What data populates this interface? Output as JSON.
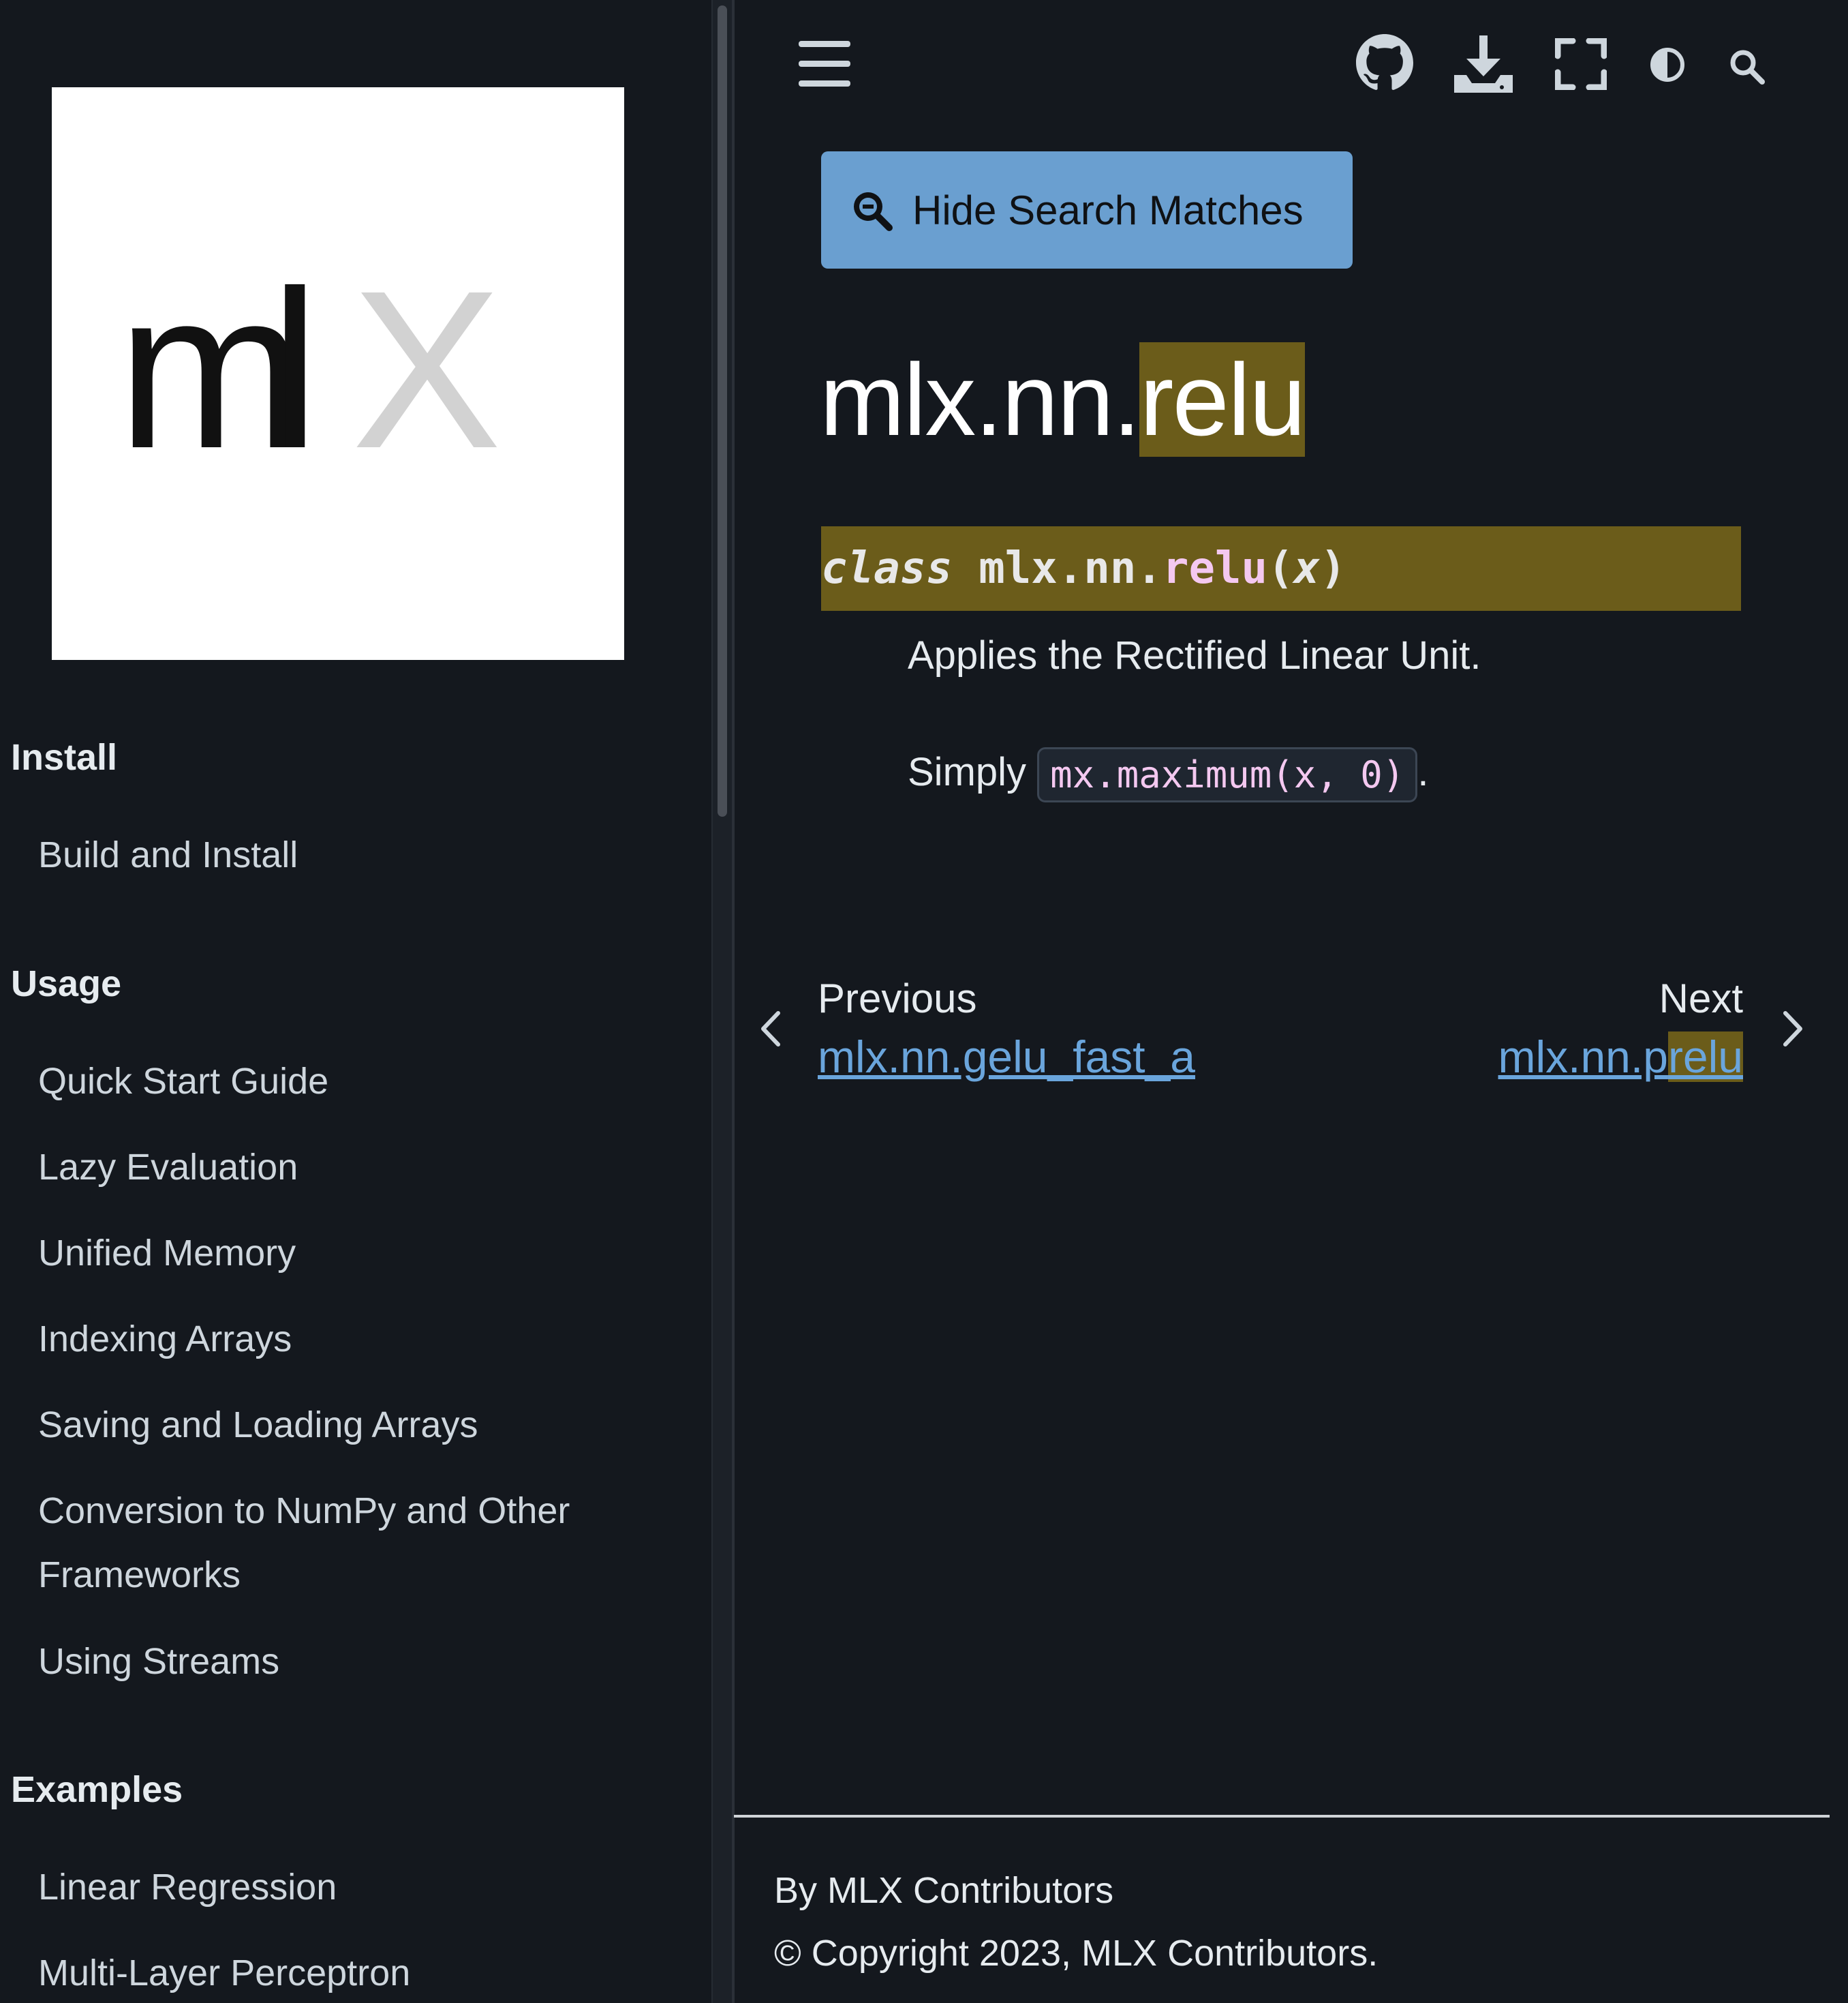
{
  "logo": {
    "text_m": "m",
    "text_l": "l",
    "text_x": "X"
  },
  "sidebar": {
    "sections": [
      {
        "caption": "Install",
        "items": [
          "Build and Install"
        ]
      },
      {
        "caption": "Usage",
        "items": [
          "Quick Start Guide",
          "Lazy Evaluation",
          "Unified Memory",
          "Indexing Arrays",
          "Saving and Loading Arrays",
          "Conversion to NumPy and Other Frameworks",
          "Using Streams"
        ]
      },
      {
        "caption": "Examples",
        "items": [
          "Linear Regression",
          "Multi-Layer Perceptron"
        ]
      }
    ]
  },
  "header": {
    "icons": [
      "menu-icon",
      "github-icon",
      "download-icon",
      "fullscreen-icon",
      "theme-toggle-icon",
      "search-icon"
    ]
  },
  "search_button": {
    "label": "Hide Search Matches",
    "icon": "search-minus-icon"
  },
  "page": {
    "title_prefix": "mlx.nn.",
    "title_highlight": "relu",
    "signature": {
      "keyword": "class",
      "module": "mlx.nn.",
      "name": "relu",
      "open": "(",
      "param": "x",
      "close": ")"
    },
    "description": "Applies the Rectified Linear Unit.",
    "simply_text": "Simply",
    "code": "mx.maximum(x, 0)",
    "period": "."
  },
  "prev_next": {
    "prev_label": "Previous",
    "prev_link": "mlx.nn.gelu_fast_a",
    "next_label": "Next",
    "next_link_prefix": "mlx.nn.p",
    "next_link_highlight": "relu"
  },
  "footer": {
    "by": "By MLX Contributors",
    "copyright": "© Copyright 2023, MLX Contributors."
  },
  "colors": {
    "background": "#14181e",
    "highlight": "#6b5c1a",
    "button": "#6a9fd0",
    "link": "#6aa5dc"
  }
}
